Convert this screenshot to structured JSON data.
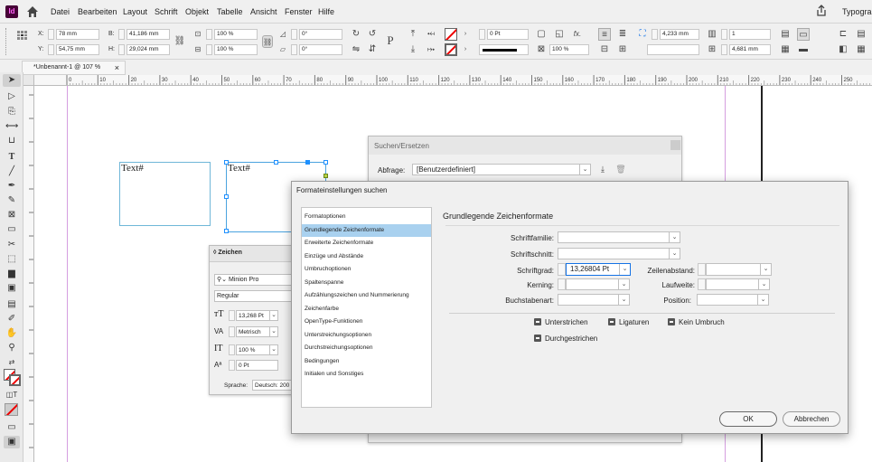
{
  "app": {
    "logo": "Id",
    "workspace": "Typograp"
  },
  "menu": [
    "Datei",
    "Bearbeiten",
    "Layout",
    "Schrift",
    "Objekt",
    "Tabelle",
    "Ansicht",
    "Fenster",
    "Hilfe"
  ],
  "control": {
    "x_label": "X:",
    "x_value": "78 mm",
    "y_label": "Y:",
    "y_value": "54,75 mm",
    "b_label": "B:",
    "b_value": "41,186 mm",
    "h_label": "H:",
    "h_value": "29,024 mm",
    "scale_x": "100 %",
    "scale_y": "100 %",
    "rotate": "0°",
    "shear": "0°",
    "stroke_weight": "0 Pt",
    "tint": "100 %",
    "fx_label": "fx.",
    "gutter": "4,233 mm",
    "columns": "1",
    "column_width": "4,681 mm"
  },
  "doc_tab": {
    "title": "*Unbenannt-1 @ 107 %",
    "close": "×"
  },
  "ruler_marks": [
    "0",
    "10",
    "20",
    "30",
    "40",
    "50",
    "60",
    "70",
    "80",
    "90",
    "100",
    "110",
    "120",
    "130",
    "140",
    "150",
    "160",
    "170",
    "180",
    "190",
    "200",
    "210",
    "220",
    "230",
    "240",
    "250"
  ],
  "frames": [
    {
      "text": "Text#"
    },
    {
      "text": "Text#"
    }
  ],
  "find_panel": {
    "title": "Suchen/Ersetzen",
    "query_label": "Abfrage:",
    "query_value": "[Benutzerdefiniert]"
  },
  "char_panel": {
    "title": "Zeichen",
    "font": "Minion Pro",
    "style": "Regular",
    "size": "13,268 Pt",
    "kerning": "Metrisch",
    "scale": "100 %",
    "baseline": "0 Pt",
    "language_label": "Sprache:",
    "language": "Deutsch: 200"
  },
  "dialog": {
    "title": "Formateinstellungen suchen",
    "categories": [
      "Formatoptionen",
      "Grundlegende Zeichenformate",
      "Erweiterte Zeichenformate",
      "Einzüge und Abstände",
      "Umbruchoptionen",
      "Spaltenspanne",
      "Aufzählungszeichen und Nummerierung",
      "Zeichenfarbe",
      "OpenType-Funktionen",
      "Unterstreichungsoptionen",
      "Durchstreichungsoptionen",
      "Bedingungen",
      "Initialen und Sonstiges"
    ],
    "selected_index": 1,
    "section_title": "Grundlegende Zeichenformate",
    "schriftfamilie_label": "Schriftfamilie:",
    "schriftschnitt_label": "Schriftschnitt:",
    "schriftgrad_label": "Schriftgrad:",
    "schriftgrad_value": "13,26804 Pt",
    "zeilenabstand_label": "Zeilenabstand:",
    "kerning_label": "Kerning:",
    "laufweite_label": "Laufweite:",
    "buchstabenart_label": "Buchstabenart:",
    "position_label": "Position:",
    "checkboxes": [
      "Unterstrichen",
      "Ligaturen",
      "Kein Umbruch",
      "Durchgestrichen"
    ],
    "ok": "OK",
    "cancel": "Abbrechen"
  }
}
